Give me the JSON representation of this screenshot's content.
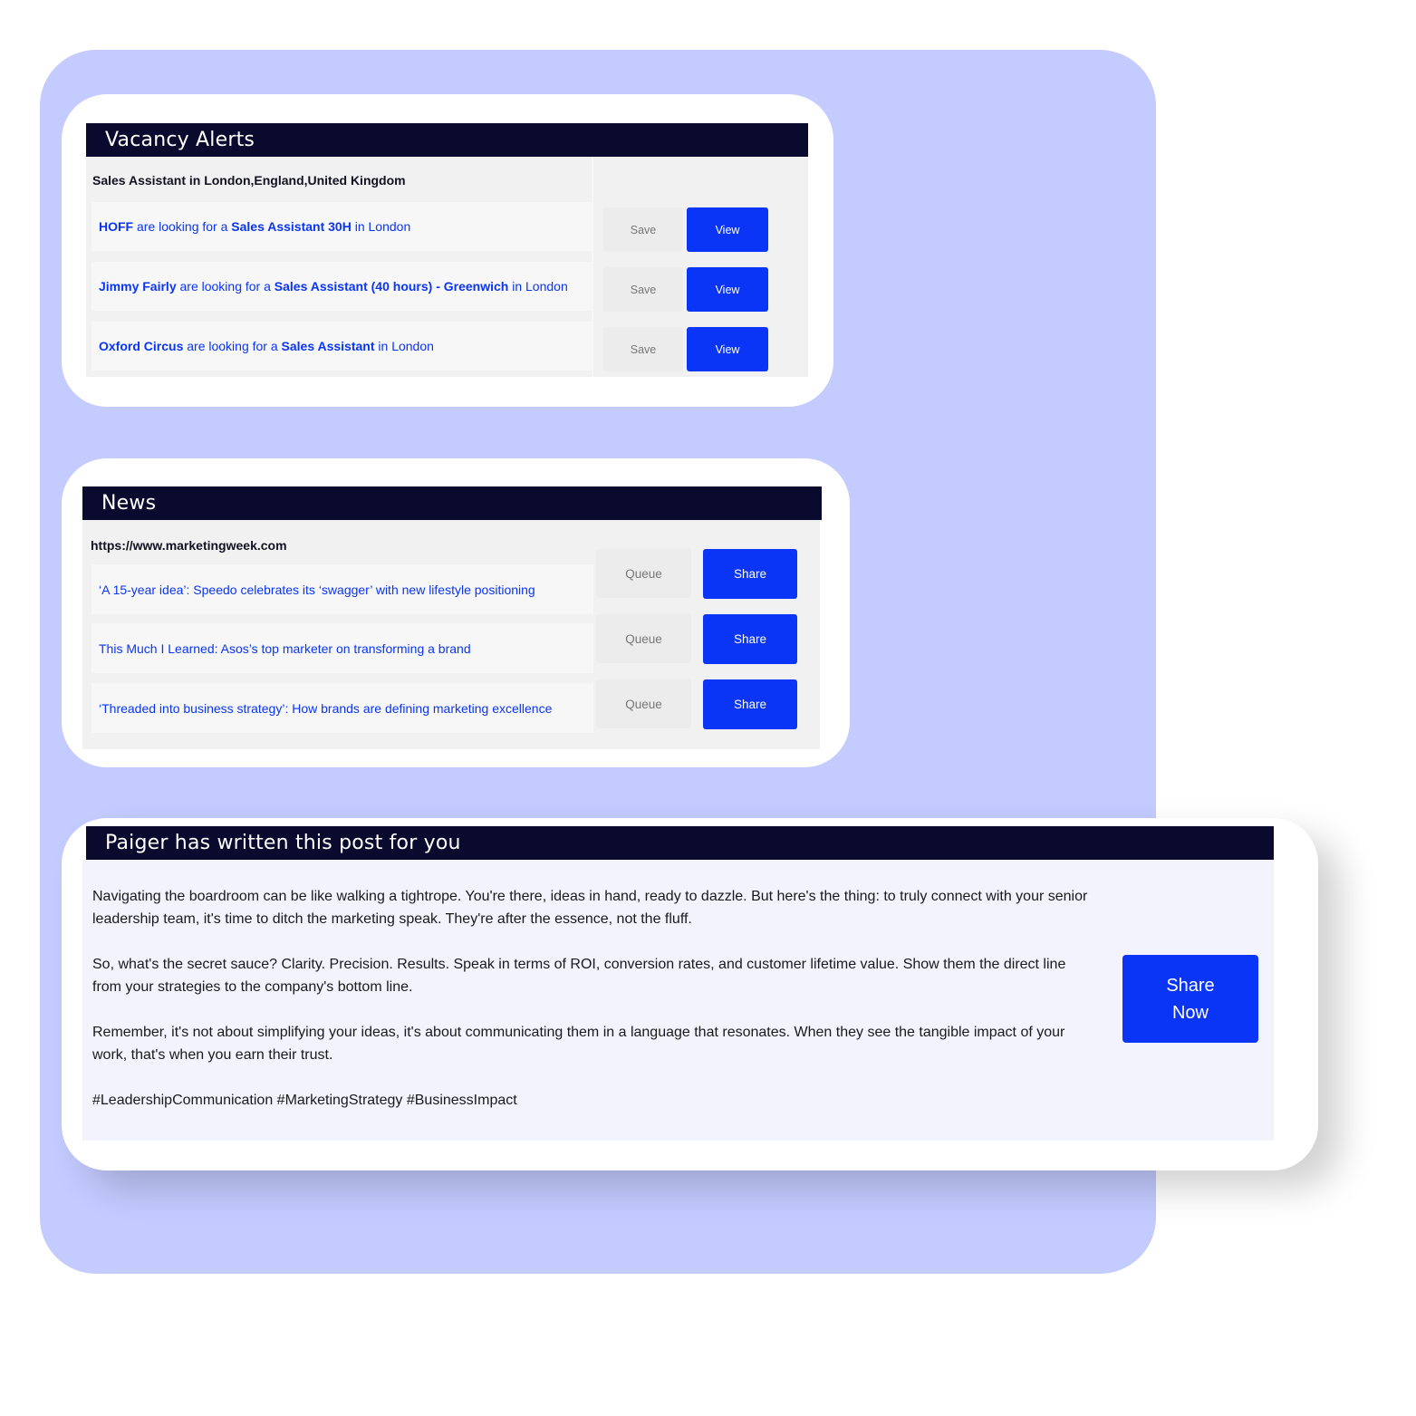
{
  "colors": {
    "background_panel": "#c3cbff",
    "header_bar": "#0a0a2e",
    "primary_button": "#0a35f7",
    "link_text": "#0a35f5",
    "secondary_button": "#ececec"
  },
  "vacancy_alerts": {
    "title": "Vacancy Alerts",
    "group_title": "Sales Assistant in London,England,United Kingdom",
    "items": [
      {
        "company": "HOFF",
        "connector": " are looking for a ",
        "role": "Sales Assistant 30H",
        "location": " in London",
        "save_label": "Save",
        "view_label": "View"
      },
      {
        "company": "Jimmy Fairly",
        "connector": " are looking for a ",
        "role": "Sales Assistant (40 hours) - Greenwich",
        "location": " in London",
        "save_label": "Save",
        "view_label": "View"
      },
      {
        "company": "Oxford Circus",
        "connector": " are looking for a ",
        "role": "Sales Assistant",
        "location": " in London",
        "save_label": "Save",
        "view_label": "View"
      }
    ]
  },
  "news": {
    "title": "News",
    "source": "https://www.marketingweek.com",
    "items": [
      {
        "headline": "‘A 15-year idea’: Speedo celebrates its ‘swagger’ with new lifestyle positioning",
        "queue_label": "Queue",
        "share_label": "Share"
      },
      {
        "headline": "This Much I Learned: Asos’s top marketer on transforming a brand",
        "queue_label": "Queue",
        "share_label": "Share"
      },
      {
        "headline": "‘Threaded into business strategy’: How brands are defining marketing excellence",
        "queue_label": "Queue",
        "share_label": "Share"
      }
    ]
  },
  "post": {
    "title": "Paiger has written this post for you",
    "paragraphs": [
      "Navigating the boardroom can be like walking a tightrope. You're there, ideas in hand, ready to dazzle. But here's the thing: to truly connect with your senior leadership team, it's time to ditch the marketing speak. They're after the essence, not the fluff.",
      "So, what's the secret sauce? Clarity. Precision. Results. Speak in terms of ROI, conversion rates, and customer lifetime value. Show them the direct line from your strategies to the company's bottom line.",
      "Remember, it's not about simplifying your ideas, it's about communicating them in a language that resonates. When they see the tangible impact of your work, that's when you earn their trust.",
      "#LeadershipCommunication #MarketingStrategy #BusinessImpact"
    ],
    "share_now_label": "Share Now"
  }
}
